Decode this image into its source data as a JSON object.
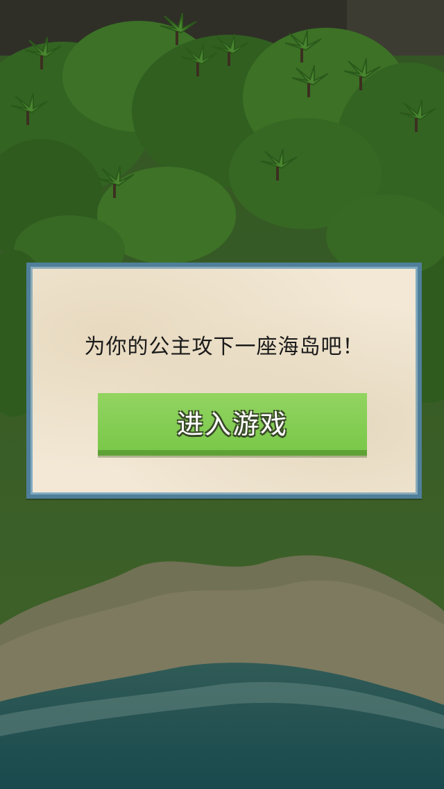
{
  "dialog": {
    "message": "为你的公主攻下一座海岛吧！",
    "enter_button_label": "进入游戏"
  },
  "colors": {
    "dialog_background": "#f2e8d5",
    "dialog_border": "#4f7f9a",
    "button_green": "#7ac84a",
    "button_shadow": "#5ea235"
  },
  "icons": [
    "palm-tree-icon"
  ]
}
